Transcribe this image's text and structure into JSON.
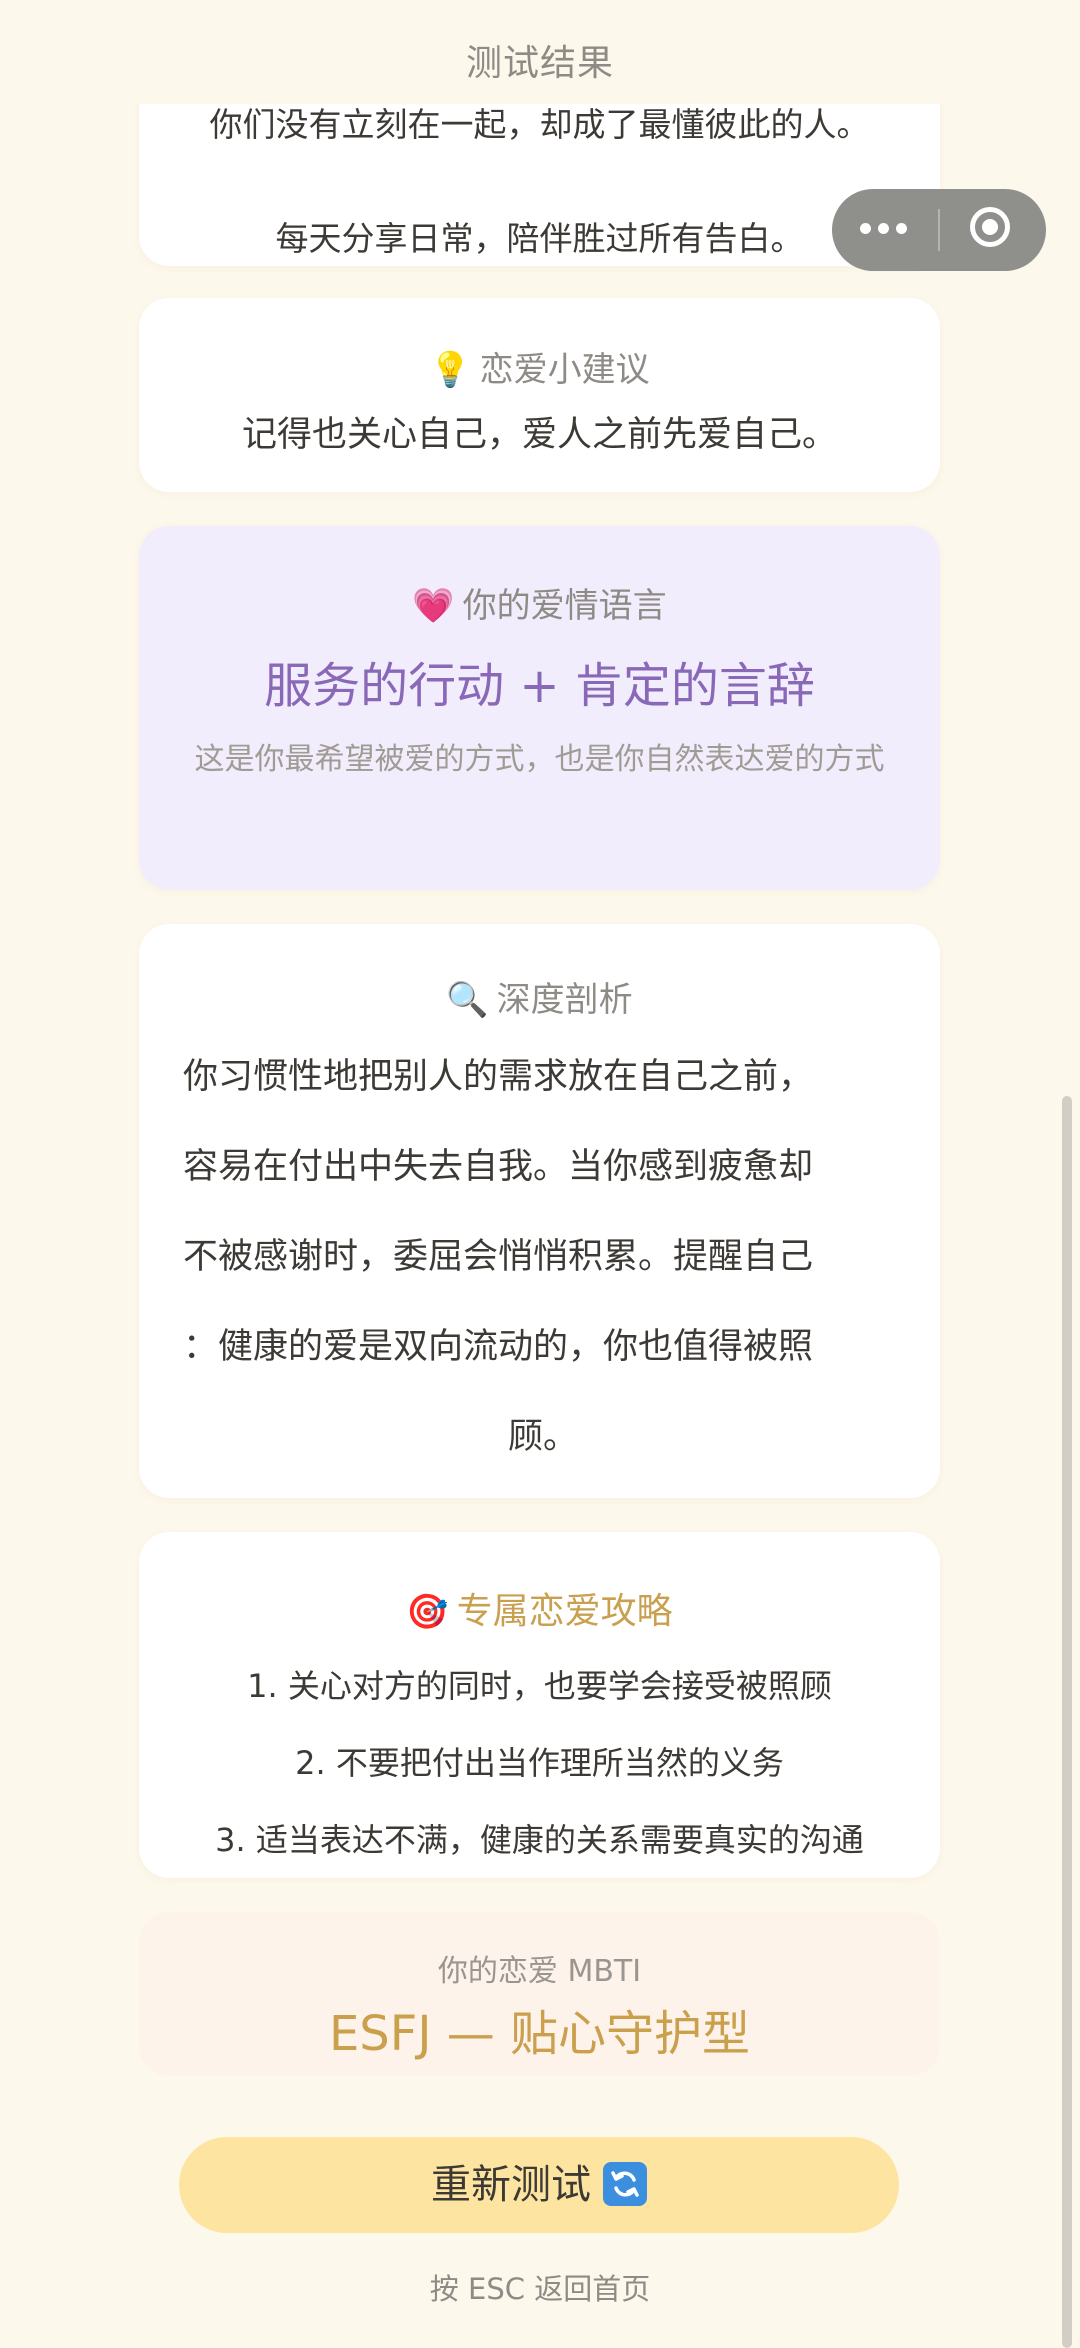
{
  "header": {
    "title": "测试结果"
  },
  "capsule": {
    "more_icon": "more-dots-icon",
    "close_icon": "target-close-icon"
  },
  "story": {
    "line1": "你们没有立刻在一起，却成了最懂彼此的人。",
    "line2": "每天分享日常，陪伴胜过所有告白。"
  },
  "tip": {
    "icon": "💡",
    "title": "恋爱小建议",
    "body": "记得也关心自己，爱人之前先爱自己。"
  },
  "love_language": {
    "icon": "💗",
    "title": "你的爱情语言",
    "headline": "服务的行动 + 肯定的言辞",
    "desc": "这是你最希望被爱的方式，也是你自然表达爱的方式",
    "accent_color": "#8a68b8",
    "background": "#f2edfc"
  },
  "analysis": {
    "icon": "🔍",
    "title": "深度剖析",
    "lines": [
      "你习惯性地把别人的需求放在自己之前，",
      "容易在付出中失去自我。当你感到疲惫却",
      "不被感谢时，委屈会悄悄积累。提醒自己",
      "：健康的爱是双向流动的，你也值得被照",
      "顾。"
    ]
  },
  "strategy": {
    "icon": "🎯",
    "title": "专属恋爱攻略",
    "title_color": "#c9a050",
    "items": [
      "1. 关心对方的同时，也要学会接受被照顾",
      "2. 不要把付出当作理所当然的义务",
      "3. 适当表达不满，健康的关系需要真实的沟通"
    ]
  },
  "mbti": {
    "label": "你的恋爱 MBTI",
    "type": "ESFJ — 贴心守护型",
    "accent_color": "#caa04c"
  },
  "retest_button": {
    "label": "重新测试",
    "icon": "refresh-icon",
    "background": "#fde4a0"
  },
  "esc_hint": "按 ESC 返回首页"
}
